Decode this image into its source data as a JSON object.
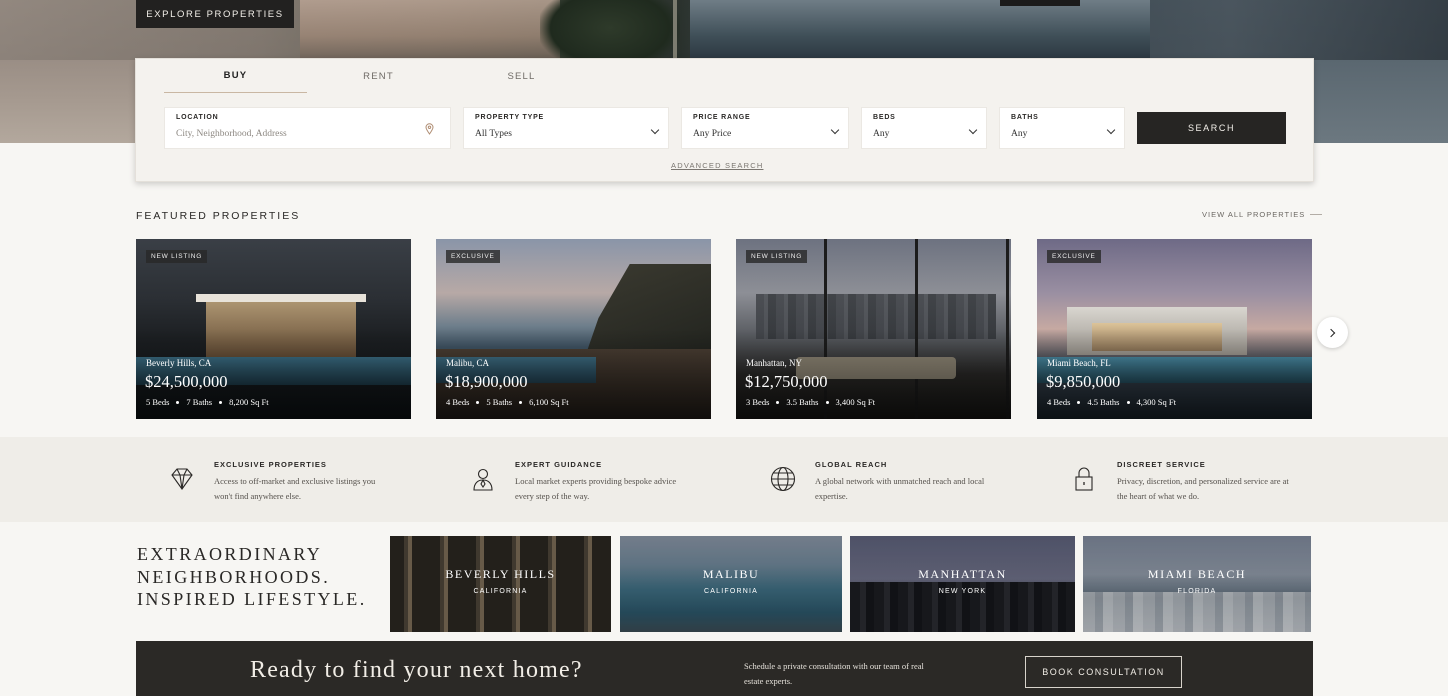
{
  "hero": {
    "explore_label": "EXPLORE PROPERTIES"
  },
  "search": {
    "tabs": [
      "BUY",
      "RENT",
      "SELL"
    ],
    "active_tab": "BUY",
    "location": {
      "label": "LOCATION",
      "placeholder": "City, Neighborhood, Address",
      "icon": "map-pin-icon"
    },
    "property_type": {
      "label": "PROPERTY TYPE",
      "value": "All Types"
    },
    "price_range": {
      "label": "PRICE RANGE",
      "value": "Any Price"
    },
    "beds": {
      "label": "BEDS",
      "value": "Any"
    },
    "baths": {
      "label": "BATHS",
      "value": "Any"
    },
    "search_label": "SEARCH",
    "advanced_label": "ADVANCED SEARCH"
  },
  "featured": {
    "title": "FEATURED PROPERTIES",
    "view_all": "VIEW ALL PROPERTIES",
    "cards": [
      {
        "badge": "NEW LISTING",
        "location": "Beverly Hills, CA",
        "price": "$24,500,000",
        "beds": "5 Beds",
        "baths": "7 Baths",
        "sqft": "8,200 Sq Ft"
      },
      {
        "badge": "EXCLUSIVE",
        "location": "Malibu, CA",
        "price": "$18,900,000",
        "beds": "4 Beds",
        "baths": "5 Baths",
        "sqft": "6,100 Sq Ft"
      },
      {
        "badge": "NEW LISTING",
        "location": "Manhattan, NY",
        "price": "$12,750,000",
        "beds": "3 Beds",
        "baths": "3.5 Baths",
        "sqft": "3,400 Sq Ft"
      },
      {
        "badge": "EXCLUSIVE",
        "location": "Miami Beach, FL",
        "price": "$9,850,000",
        "beds": "4 Beds",
        "baths": "4.5 Baths",
        "sqft": "4,300 Sq Ft"
      }
    ]
  },
  "features": [
    {
      "icon": "diamond-icon",
      "title": "EXCLUSIVE PROPERTIES",
      "desc": "Access to off-market and exclusive listings you won't find anywhere else."
    },
    {
      "icon": "advisor-icon",
      "title": "EXPERT GUIDANCE",
      "desc": "Local market experts providing bespoke advice every step of the way."
    },
    {
      "icon": "globe-icon",
      "title": "GLOBAL REACH",
      "desc": "A global network with unmatched reach and local expertise."
    },
    {
      "icon": "lock-icon",
      "title": "DISCREET SERVICE",
      "desc": "Privacy, discretion, and personalized service are at the heart of what we do."
    }
  ],
  "neighborhoods": {
    "title_lines": [
      "EXTRAORDINARY",
      "NEIGHBORHOODS.",
      "INSPIRED LIFESTYLE."
    ],
    "items": [
      {
        "name": "BEVERLY HILLS",
        "state": "CALIFORNIA"
      },
      {
        "name": "MALIBU",
        "state": "CALIFORNIA"
      },
      {
        "name": "MANHATTAN",
        "state": "NEW YORK"
      },
      {
        "name": "MIAMI BEACH",
        "state": "FLORIDA"
      }
    ]
  },
  "cta": {
    "heading": "Ready to find your next home?",
    "text": "Schedule a private consultation with our team of real estate experts.",
    "button": "BOOK CONSULTATION"
  }
}
